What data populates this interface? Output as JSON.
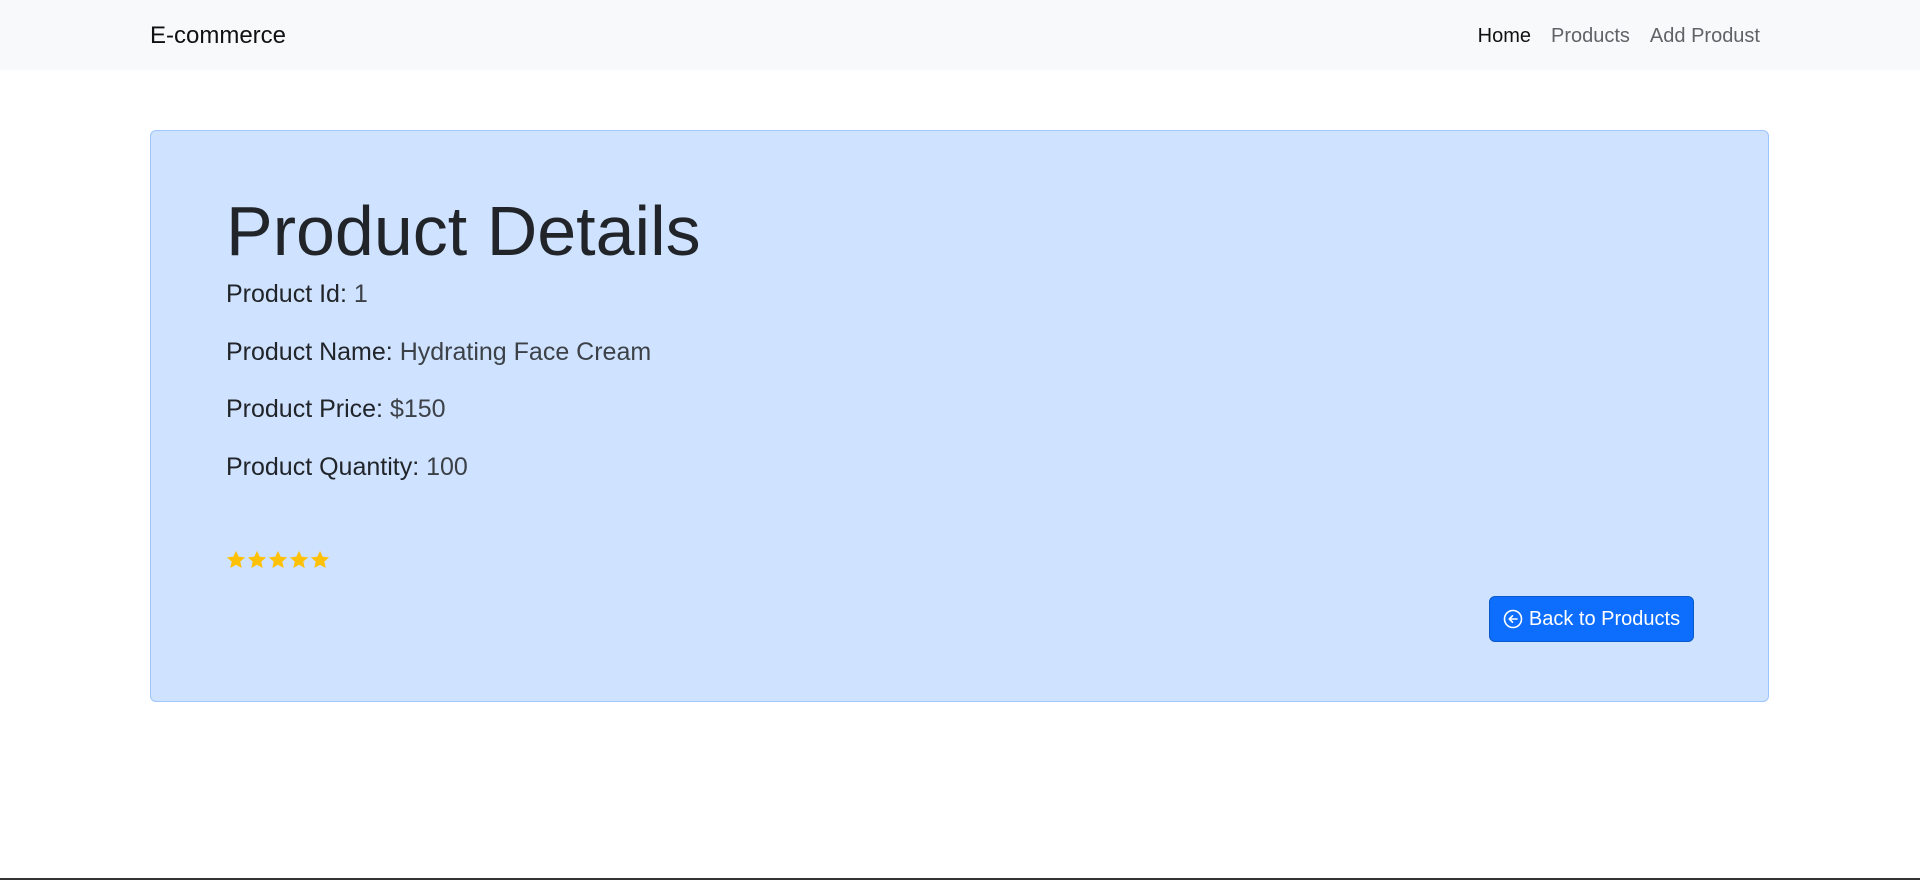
{
  "navbar": {
    "brand": "E-commerce",
    "links": [
      {
        "label": "Home",
        "active": true
      },
      {
        "label": "Products",
        "active": false
      },
      {
        "label": "Add Produst",
        "active": false
      }
    ]
  },
  "product": {
    "heading": "Product Details",
    "id_label": "Product Id:",
    "id_value": "1",
    "name_label": "Product Name:",
    "name_value": "Hydrating Face Cream",
    "price_label": "Product Price:",
    "price_value": "$150",
    "quantity_label": "Product Quantity:",
    "quantity_value": "100",
    "rating": 5,
    "rating_max": 5
  },
  "actions": {
    "back_label": "Back to Products",
    "back_icon": "arrow-left-circle-icon"
  },
  "colors": {
    "card_bg": "#cfe2ff",
    "button_bg": "#0d6efd",
    "star": "#ffc107"
  }
}
